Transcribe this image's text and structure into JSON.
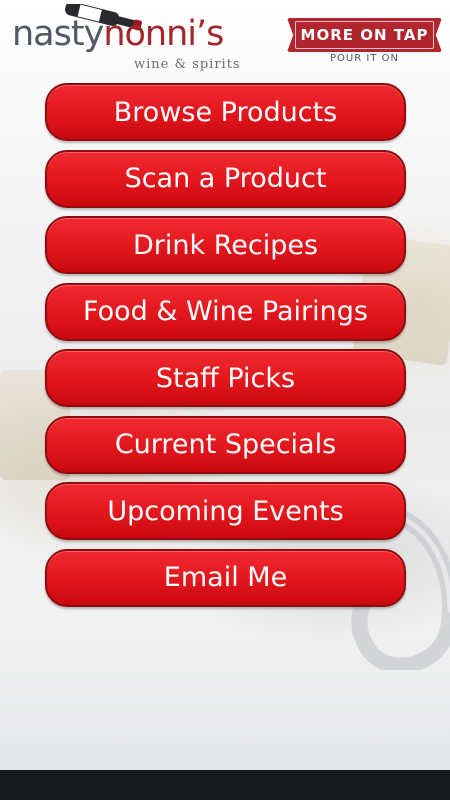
{
  "header": {
    "logo": {
      "name_parts": [
        "nasty",
        "nonni’s"
      ],
      "tagline": "wine & spirits"
    },
    "badge": {
      "title": "MORE ON TAP",
      "tagline": "POUR IT ON"
    }
  },
  "menu": {
    "items": [
      {
        "label": "Browse Products"
      },
      {
        "label": "Scan a Product"
      },
      {
        "label": "Drink Recipes"
      },
      {
        "label": "Food & Wine Pairings"
      },
      {
        "label": "Staff Picks"
      },
      {
        "label": "Current Specials"
      },
      {
        "label": "Upcoming Events"
      },
      {
        "label": "Email Me"
      }
    ]
  },
  "colors": {
    "button_red": "#e2161d",
    "brand_red": "#b1262e",
    "logo_gray": "#505a66",
    "navbar": "#16191c"
  }
}
